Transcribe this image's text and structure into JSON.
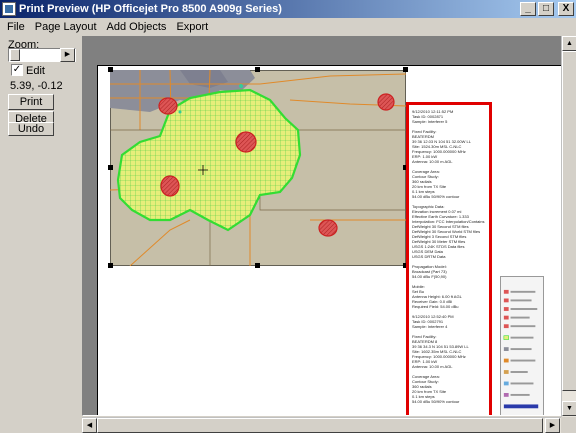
{
  "window": {
    "title": "Print Preview (HP Officejet Pro 8500 A909g Series)",
    "minimize": "_",
    "maximize": "□",
    "close": "X"
  },
  "menu": [
    "File",
    "Page Layout",
    "Add Objects",
    "Export"
  ],
  "left": {
    "zoom_label": "Zoom:",
    "edit_checked": "✓",
    "edit_label": "Edit",
    "coords": "5.39, -0.12",
    "print_label": "Print",
    "delete_label": "Delete",
    "undo_label": "Undo"
  },
  "report": [
    "9/12/2010 12:11:52 PM",
    "Task ID: 0002871",
    "Sample: Interferer 5",
    "",
    "Fixed Facility:",
    "  BEATERDM",
    "  39 36 12.03 N 104 51 32.00W LL",
    "  Site: 1524.30m MSL C-NLC",
    "  Frequency: 1000.000000 MHz",
    "  ERP: 1.00 kW",
    "  Antenna: 10.00 m AGL",
    "",
    "Coverage Area:",
    "  Contour Study:",
    "  360 radials",
    "  20 km from TX Site",
    "  0.1 km steps",
    "  54.00 dBu 50/90% contour",
    "",
    "Topographic Data:",
    "  Elevation increment 0.07 mi",
    "  Effective Earth Curvature: 1.333",
    "  Interpolation: FCC Interpolation/Contains",
    "  DefWeight 30 Second STM files",
    "  DefWeight 30 Second World STM files",
    "  DefWeight 3 Second STM files",
    "  DefWeight 30 Meter STM files",
    "  USGS 1:24K STDS Data files",
    "  USGS DEM Data",
    "  USGS DRTM Data",
    "",
    "Propagation Model:",
    "  Broadcast (Part 73)",
    "  54.00 dBu F(50,90)",
    "",
    "Mobile:",
    "  Set Bu",
    "  Antenna Height: 6.00 ft AGL",
    "  Receiver Gain: 0.0 dBi",
    "  Required Field: 54.00 dBu",
    "",
    "9/12/2010 12:52:40 PM",
    "Task ID: 0002791",
    "Sample: Interferer 4",
    "",
    "Fixed Facility:",
    "  BEATERDM 8",
    "  39 36 34.3 N 104 51 53.89W LL",
    "  Site: 1602.35m MSL C-NLC",
    "  Frequency: 1000.000000 MHz",
    "  ERP: 1.00 kW",
    "  Antenna: 10.00 m AGL",
    "",
    "Coverage Area:",
    "  Contour Study:",
    "  360 radials",
    "  20 km from TX Site",
    "  0.1 km steps",
    "  54.00 dBu 50/90% contour"
  ],
  "colors": {
    "map_bg": "#c6bfa8",
    "urban": "#8c8e99",
    "coverage": "#e0f070",
    "coverage_border": "#33dd33",
    "interferer": "#dd4444",
    "report_border": "#e00000"
  }
}
